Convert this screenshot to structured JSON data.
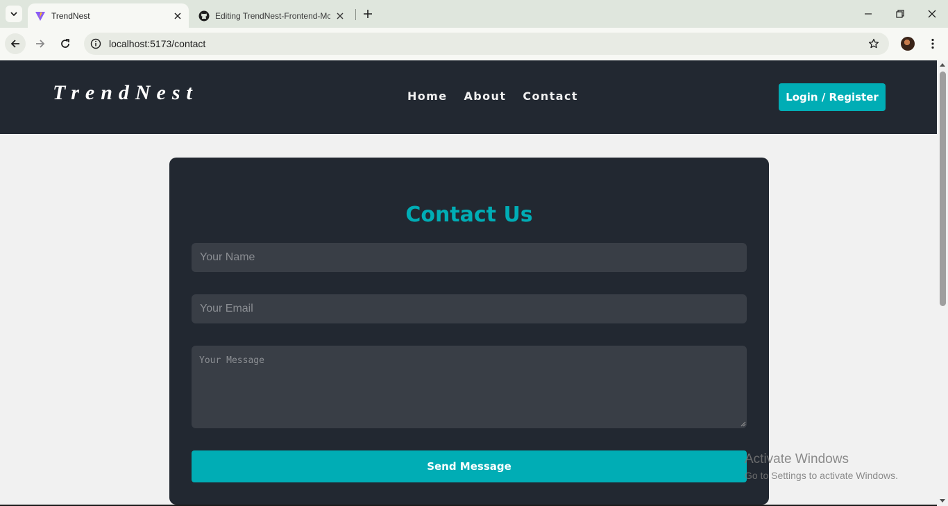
{
  "browser": {
    "tabs": [
      {
        "title": "TrendNest",
        "active": true
      },
      {
        "title": "Editing TrendNest-Frontend-Mc",
        "active": false
      }
    ],
    "url": "localhost:5173/contact"
  },
  "site": {
    "logo": "TrendNest",
    "nav": [
      "Home",
      "About",
      "Contact"
    ],
    "login_label": "Login / Register"
  },
  "contact": {
    "title": "Contact Us",
    "name_placeholder": "Your Name",
    "email_placeholder": "Your Email",
    "message_placeholder": "Your Message",
    "send_label": "Send Message"
  },
  "watermark": {
    "line1": "Activate Windows",
    "line2": "Go to Settings to activate Windows."
  },
  "colors": {
    "header_bg": "#222831",
    "accent": "#00adb5",
    "field_bg": "#393e46",
    "page_bg": "#f1f1f1"
  }
}
